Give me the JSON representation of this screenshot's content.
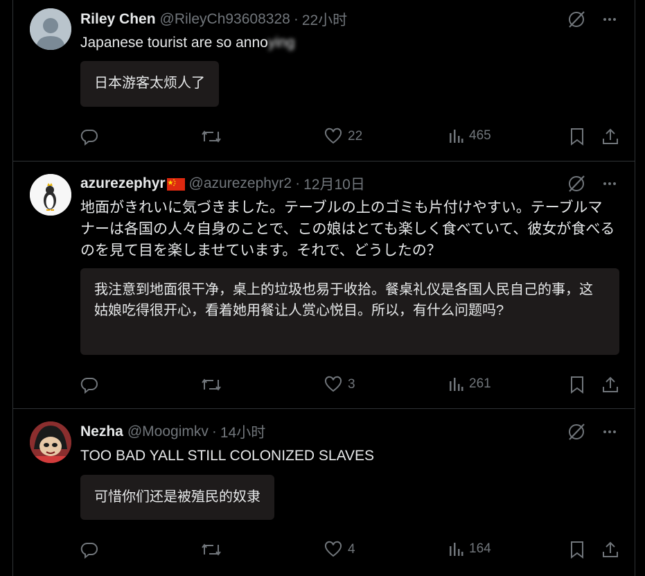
{
  "tweets": [
    {
      "name": "Riley Chen",
      "handle": "@RileyCh93608328",
      "separator": "·",
      "time": "22小时",
      "text_visible": "Japanese tourist are so anno",
      "text_obscured": "ying",
      "translation": "日本游客太烦人了",
      "likes": "22",
      "views": "465",
      "avatar": "default-avatar"
    },
    {
      "name": "azurezephyr",
      "handle": "@azurezephyr2",
      "separator": "·",
      "time": "12月10日",
      "text": "地面がきれいに気づきました。テーブルの上のゴミも片付けやすい。テーブルマナーは各国の人々自身のことで、この娘はとても楽しく食べていて、彼女が食べるのを見て目を楽しませています。それで、どうしたの？",
      "translation": "我注意到地面很干净，桌上的垃圾也易于收拾。餐桌礼仪是各国人民自己的事，这姑娘吃得很开心，看着她用餐让人赏心悦目。所以，有什么问题吗?",
      "likes": "3",
      "views": "261",
      "avatar": "penguin-avatar"
    },
    {
      "name": "Nezha",
      "handle": "@Moogimkv",
      "separator": "·",
      "time": "14小时",
      "text": "TOO BAD YALL STILL COLONIZED SLAVES",
      "translation": "可惜你们还是被殖民的奴隶",
      "likes": "4",
      "views": "164",
      "avatar": "cartoon-avatar"
    }
  ],
  "colors": {
    "background": "#000000",
    "text": "#e7e9ea",
    "muted": "#71767b",
    "translation_box": "#1e1b1b",
    "divider": "#2f3336",
    "flag_red": "#de2910",
    "flag_star": "#ffde00"
  },
  "icons": [
    "grok-icon",
    "more-icon",
    "reply-icon",
    "retweet-icon",
    "like-icon",
    "views-icon",
    "bookmark-icon",
    "share-icon"
  ]
}
